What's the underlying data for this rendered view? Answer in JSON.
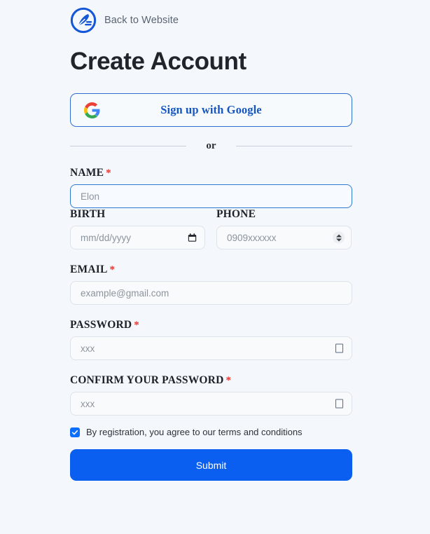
{
  "header": {
    "logo_icon": "pen-nib-circle-logo",
    "back_label": "Back to Website",
    "page_title": "Create Account"
  },
  "social": {
    "google_icon": "google-g-icon",
    "google_label": "Sign up with Google",
    "divider_label": "or"
  },
  "form": {
    "name": {
      "label": "NAME",
      "required_marker": "*",
      "placeholder": "Elon"
    },
    "birth": {
      "label": "BIRTH",
      "placeholder": "mm/dd/yyyy",
      "icon": "calendar-icon"
    },
    "phone": {
      "label": "PHONE",
      "placeholder": "0909xxxxxx",
      "icon": "number-spinner-icon"
    },
    "email": {
      "label": "EMAIL",
      "required_marker": "*",
      "placeholder": "example@gmail.com"
    },
    "password": {
      "label": "PASSWORD",
      "required_marker": "*",
      "placeholder": "xxx",
      "icon": "toggle-password-visibility-icon"
    },
    "confirm_password": {
      "label": "CONFIRM YOUR PASSWORD",
      "required_marker": "*",
      "placeholder": "xxx",
      "icon": "toggle-password-visibility-icon"
    },
    "terms": {
      "checked": true,
      "text": "By registration, you agree to our terms and conditions"
    },
    "submit_label": "Submit"
  },
  "colors": {
    "page_background": "#f4f7fb",
    "primary_blue": "#0a5ff0",
    "link_blue": "#1556c0",
    "focus_border": "#2f7ad1",
    "required_red": "#e3342f",
    "title_dark": "#21252b",
    "input_border": "#dde3ea"
  }
}
